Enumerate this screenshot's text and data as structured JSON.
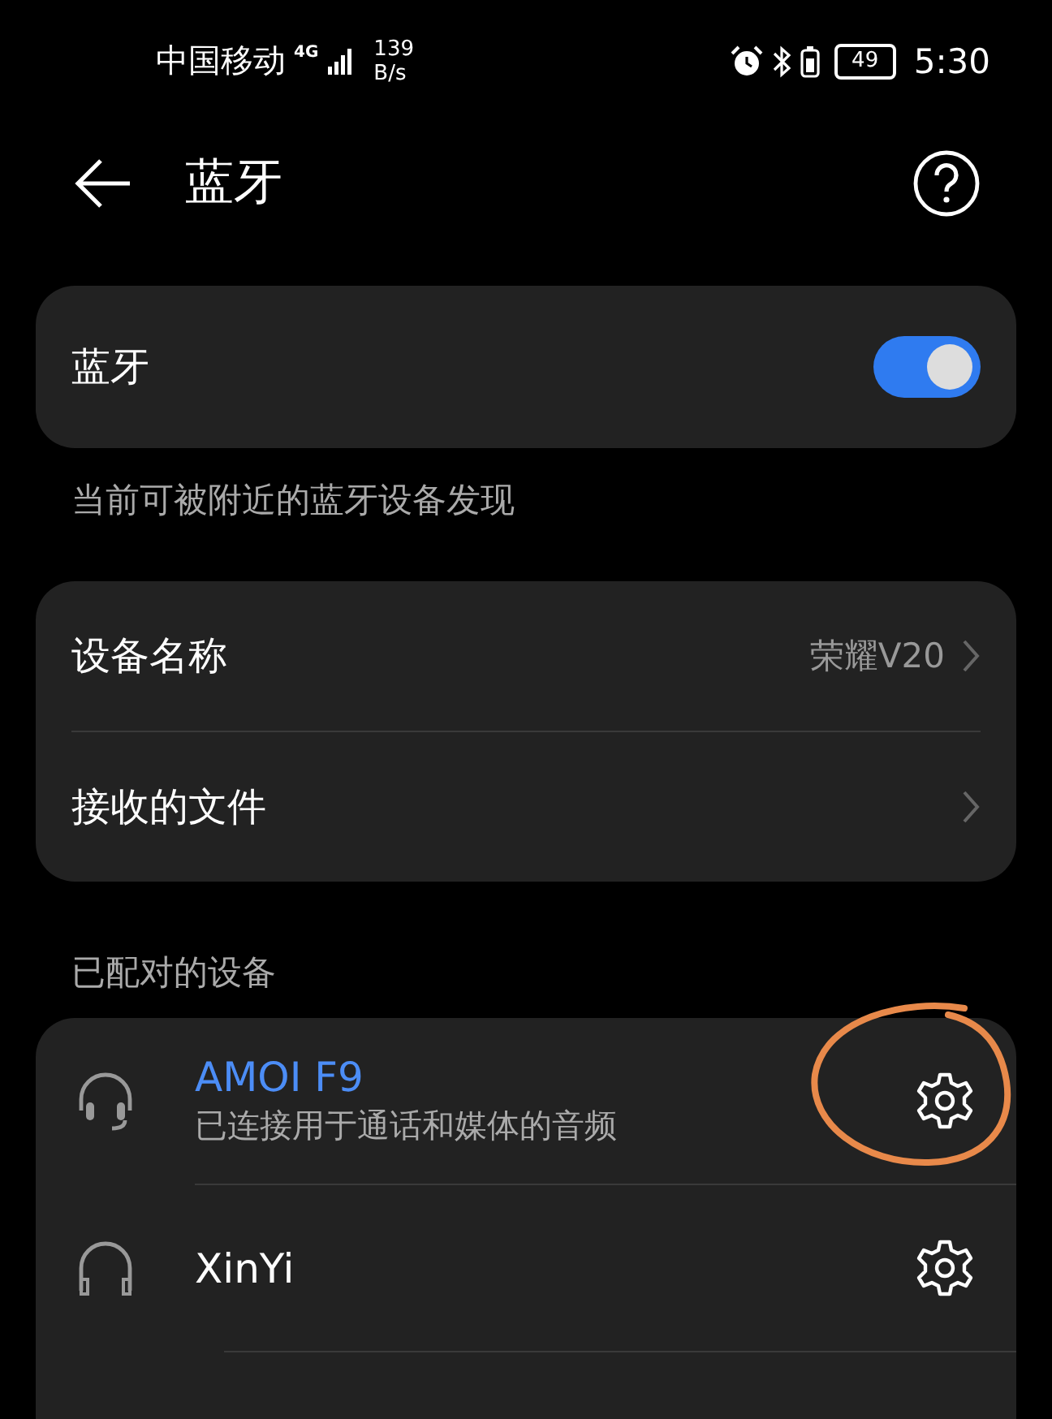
{
  "status_bar": {
    "carrier": "中国移动",
    "network": "4G",
    "speed": "139",
    "speed_unit": "B/s",
    "battery": "49",
    "time": "5:30"
  },
  "header": {
    "title": "蓝牙"
  },
  "bluetooth": {
    "label": "蓝牙",
    "on": true
  },
  "visibility_note": "当前可被附近的蓝牙设备发现",
  "settings": [
    {
      "label": "设备名称",
      "value": "荣耀V20"
    },
    {
      "label": "接收的文件"
    }
  ],
  "paired_section": {
    "title": "已配对的设备"
  },
  "paired_devices": [
    {
      "kind": "headset",
      "name": "AMOI F9",
      "status": "已连接用于通话和媒体的音频",
      "connected": true,
      "highlighted": true
    },
    {
      "kind": "headphones",
      "name": "XinYi",
      "connected": false,
      "highlighted": false
    }
  ]
}
